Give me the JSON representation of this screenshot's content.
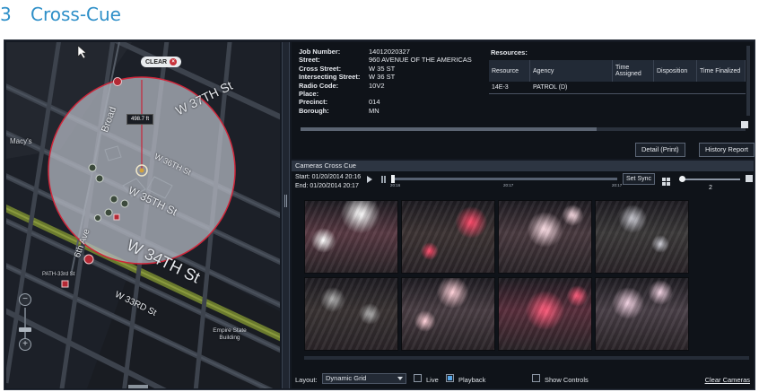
{
  "heading": {
    "number": "3",
    "title": "Cross-Cue"
  },
  "map": {
    "clear_chip": "CLEAR",
    "distance": "498.7 ft",
    "streets": {
      "w37": "W 37TH St",
      "w36": "W 36TH St",
      "w35": "W 35TH St",
      "w34": "W 34TH St",
      "w33": "W 33RD St",
      "broadway": "Broad",
      "sixth_ave": "6th Ave"
    },
    "places": {
      "macys": "Macy's",
      "path": "PATH-33rd St",
      "empire": "Empire State Building"
    }
  },
  "incident": {
    "fields": [
      {
        "key": "Job Number:",
        "value": "14012020327"
      },
      {
        "key": "Street:",
        "value": "960 AVENUE OF THE AMERICAS"
      },
      {
        "key": "Cross Street:",
        "value": "W 35 ST"
      },
      {
        "key": "Intersecting Street:",
        "value": "W 36 ST"
      },
      {
        "key": "Radio Code:",
        "value": "10V2"
      },
      {
        "key": "Place:",
        "value": ""
      },
      {
        "key": "Precinct:",
        "value": "014"
      },
      {
        "key": "Borough:",
        "value": "MN"
      }
    ],
    "resources_title": "Resources:",
    "columns": [
      "Resource",
      "Agency",
      "Time Assigned",
      "Disposition",
      "Time Finalized"
    ],
    "rows": [
      [
        "14E-3",
        "PATROL (D)",
        "",
        "",
        ""
      ]
    ],
    "detail_button": "Detail (Print)",
    "history_button": "History Report"
  },
  "cameras": {
    "title": "Cameras Cross Cue",
    "start": "Start: 01/20/2014 20:16",
    "end": "End:  01/20/2014 20:17",
    "ticks": [
      "20:16",
      "20:17",
      "20:17"
    ],
    "set_sync": "Set Sync",
    "grid_size": "2",
    "layout_label": "Layout:",
    "layout_value": "Dynamic Grid",
    "live_label": "Live",
    "playback_label": "Playback",
    "show_controls_label": "Show Controls",
    "clear_cameras": "Clear Cameras",
    "feeds": [
      {
        "tint": "#5a3a44",
        "light": "#ffffff"
      },
      {
        "tint": "#3d3434",
        "light": "#ff4a6a"
      },
      {
        "tint": "#4a3a40",
        "light": "#ffe0e8"
      },
      {
        "tint": "#3c3a3a",
        "light": "#c8c8d0"
      },
      {
        "tint": "#3a3434",
        "light": "#b0b0b0"
      },
      {
        "tint": "#4a3e44",
        "light": "#ffd0d8"
      },
      {
        "tint": "#5a2e3c",
        "light": "#ff5a7a"
      },
      {
        "tint": "#4a4048",
        "light": "#f0d0e0"
      }
    ]
  }
}
